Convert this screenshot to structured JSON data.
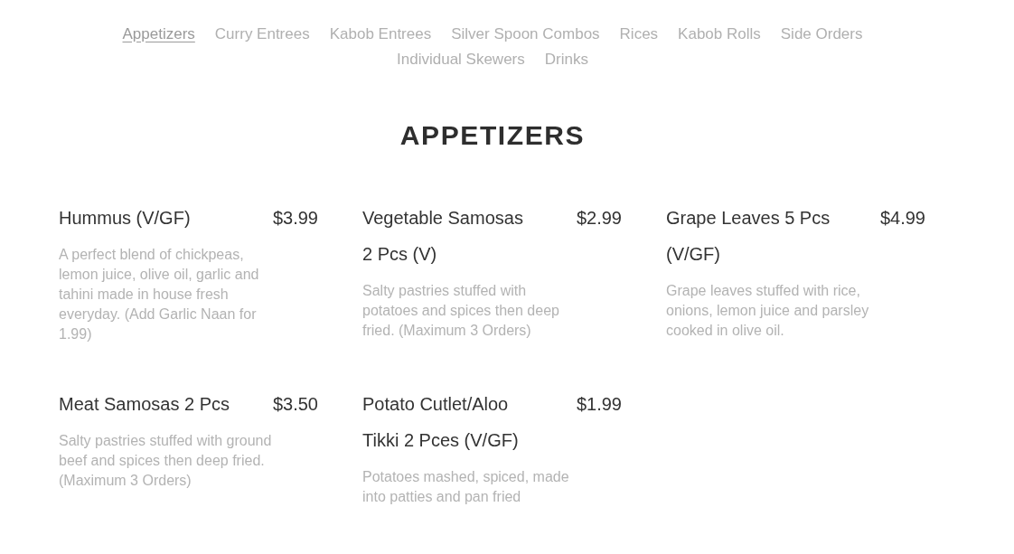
{
  "nav": {
    "links": [
      {
        "label": "Appetizers",
        "selected": true
      },
      {
        "label": "Curry Entrees",
        "selected": false
      },
      {
        "label": "Kabob Entrees",
        "selected": false
      },
      {
        "label": "Silver Spoon Combos",
        "selected": false
      },
      {
        "label": "Rices",
        "selected": false
      },
      {
        "label": "Kabob Rolls",
        "selected": false
      },
      {
        "label": "Side Orders",
        "selected": false
      },
      {
        "label": "Individual Skewers",
        "selected": false
      },
      {
        "label": "Drinks",
        "selected": false
      }
    ]
  },
  "section": {
    "title": "APPETIZERS",
    "items": [
      {
        "name": "Hummus (V/GF)",
        "price": "$3.99",
        "description": "A perfect blend of chickpeas, lemon juice, olive oil, garlic and tahini made in house fresh everyday. (Add Garlic Naan for 1.99)"
      },
      {
        "name": "Vegetable Samosas 2 Pcs (V)",
        "price": "$2.99",
        "description": "Salty pastries stuffed with potatoes and spices then deep fried. (Maximum 3 Orders)"
      },
      {
        "name": "Grape Leaves 5 Pcs (V/GF)",
        "price": "$4.99",
        "description": "Grape leaves stuffed with rice, onions, lemon juice and parsley cooked in olive oil."
      },
      {
        "name": "Meat Samosas 2 Pcs",
        "price": "$3.50",
        "description": "Salty pastries stuffed with ground beef and spices then deep fried. (Maximum 3 Orders)"
      },
      {
        "name": "Potato Cutlet/Aloo Tikki 2 Pces (V/GF)",
        "price": "$1.99",
        "description": "Potatoes mashed, spiced, made into patties and pan fried"
      }
    ]
  }
}
